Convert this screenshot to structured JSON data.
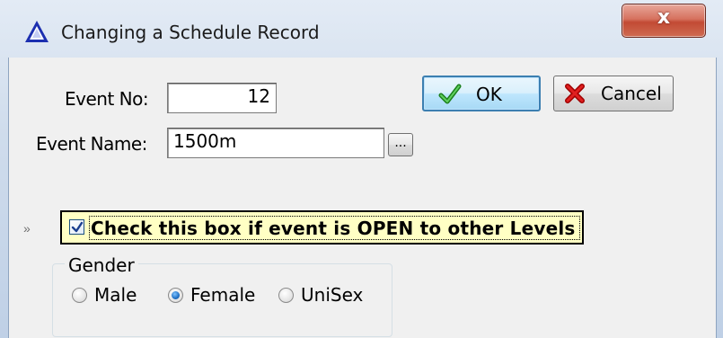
{
  "window": {
    "title": "Changing a Schedule Record",
    "close_glyph": "x"
  },
  "form": {
    "event_no_label": "Event No:",
    "event_no_value": "12",
    "event_name_label": "Event Name:",
    "event_name_value": "1500m",
    "browse_label": "..."
  },
  "buttons": {
    "ok_label": "OK",
    "cancel_label": "Cancel"
  },
  "open_checkbox": {
    "label": "Check this box if event is OPEN to other Levels",
    "checked": true,
    "row_marker": "»"
  },
  "gender": {
    "title": "Gender",
    "options": [
      {
        "label": "Male",
        "selected": false
      },
      {
        "label": "Female",
        "selected": true
      },
      {
        "label": "UniSex",
        "selected": false
      }
    ]
  },
  "colors": {
    "accent": "#3c7fb1",
    "highlight": "#ffffc4",
    "close": "#c24a34"
  },
  "icons": {
    "title": "triangle-app-icon",
    "ok": "green-check-icon",
    "cancel": "red-x-icon"
  }
}
